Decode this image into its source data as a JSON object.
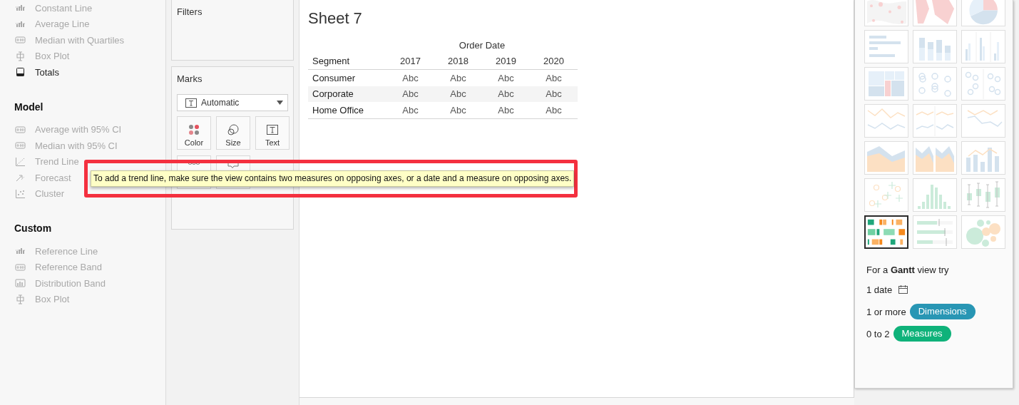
{
  "analytics": {
    "sections": [
      {
        "items": [
          {
            "label": "Constant Line",
            "kind": "bar-line",
            "disabled": true
          },
          {
            "label": "Average Line",
            "kind": "bar-line",
            "disabled": true
          },
          {
            "label": "Median with Quartiles",
            "kind": "band",
            "disabled": true
          },
          {
            "label": "Box Plot",
            "kind": "box-plot",
            "disabled": true
          },
          {
            "label": "Totals",
            "kind": "totals",
            "disabled": false
          }
        ]
      },
      {
        "title": "Model",
        "items": [
          {
            "label": "Average with 95% CI",
            "kind": "band",
            "disabled": true
          },
          {
            "label": "Median with 95% CI",
            "kind": "band",
            "disabled": true
          },
          {
            "label": "Trend Line",
            "kind": "trend",
            "disabled": true
          },
          {
            "label": "Forecast",
            "kind": "forecast",
            "disabled": true
          },
          {
            "label": "Cluster",
            "kind": "cluster",
            "disabled": true
          }
        ]
      },
      {
        "title": "Custom",
        "items": [
          {
            "label": "Reference Line",
            "kind": "bar-line",
            "disabled": true
          },
          {
            "label": "Reference Band",
            "kind": "band",
            "disabled": true
          },
          {
            "label": "Distribution Band",
            "kind": "distribution",
            "disabled": true
          },
          {
            "label": "Box Plot",
            "kind": "box-plot",
            "disabled": true
          }
        ]
      }
    ]
  },
  "shelves": {
    "filters": {
      "title": "Filters"
    },
    "marks": {
      "title": "Marks",
      "mark_type": "Automatic",
      "cards": [
        {
          "kind": "color",
          "label": "Color"
        },
        {
          "kind": "size",
          "label": "Size"
        },
        {
          "kind": "text",
          "label": "Text"
        },
        {
          "kind": "detail"
        },
        {
          "kind": "tooltip"
        }
      ]
    }
  },
  "view": {
    "title": "Sheet 7",
    "column_header": "Order Date",
    "row_header": "Segment",
    "columns": [
      "2017",
      "2018",
      "2019",
      "2020"
    ],
    "rows": [
      {
        "label": "Consumer",
        "cells": [
          "Abc",
          "Abc",
          "Abc",
          "Abc"
        ]
      },
      {
        "label": "Corporate",
        "cells": [
          "Abc",
          "Abc",
          "Abc",
          "Abc"
        ]
      },
      {
        "label": "Home Office",
        "cells": [
          "Abc",
          "Abc",
          "Abc",
          "Abc"
        ]
      }
    ]
  },
  "tooltip": {
    "text": "To add a trend line, make sure the view contains two measures on opposing axes, or a date and a measure on opposing axes."
  },
  "show_me": {
    "charts": [
      {
        "kind": "symbol-map",
        "selected": false
      },
      {
        "kind": "filled-map",
        "selected": false
      },
      {
        "kind": "pie",
        "selected": false
      },
      {
        "kind": "hbar",
        "selected": false
      },
      {
        "kind": "stacked-bar",
        "selected": false
      },
      {
        "kind": "side-bar",
        "selected": false
      },
      {
        "kind": "treemap",
        "selected": false
      },
      {
        "kind": "circles",
        "selected": false
      },
      {
        "kind": "side-circles",
        "selected": false
      },
      {
        "kind": "line-cont",
        "selected": false
      },
      {
        "kind": "line-disc",
        "selected": false
      },
      {
        "kind": "dual-line",
        "selected": false
      },
      {
        "kind": "area-cont",
        "selected": false
      },
      {
        "kind": "area-disc",
        "selected": false
      },
      {
        "kind": "combo",
        "selected": false
      },
      {
        "kind": "scatter",
        "selected": false
      },
      {
        "kind": "histogram",
        "selected": false
      },
      {
        "kind": "box-whisker",
        "selected": false
      },
      {
        "kind": "gantt",
        "selected": true
      },
      {
        "kind": "bullet",
        "selected": false
      },
      {
        "kind": "bubbles",
        "selected": false
      }
    ],
    "hint": "For a **Gantt** view try",
    "requirements": [
      {
        "kind": "date",
        "count": "1 date"
      },
      {
        "kind": "pill",
        "count": "1 or more",
        "pill": "Dimensions",
        "color": "#2896b4"
      },
      {
        "kind": "pill",
        "count": "0 to 2",
        "pill": "Measures",
        "color": "#0fb27a"
      }
    ]
  }
}
